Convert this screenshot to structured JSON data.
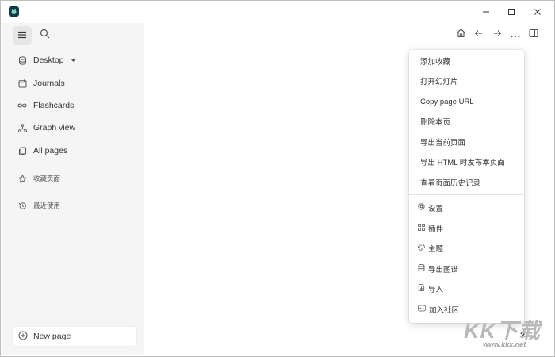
{
  "window": {
    "controls": {
      "minimize": "─",
      "maximize": "☐",
      "close": "✕"
    }
  },
  "sidebar": {
    "items": [
      {
        "label": "Desktop",
        "icon": "database-icon"
      },
      {
        "label": "Journals",
        "icon": "calendar-icon"
      },
      {
        "label": "Flashcards",
        "icon": "infinity-icon"
      },
      {
        "label": "Graph view",
        "icon": "graph-icon"
      },
      {
        "label": "All pages",
        "icon": "pages-icon"
      }
    ],
    "favorites_label": "收藏页面",
    "recent_label": "最近使用",
    "new_page_label": "New page"
  },
  "menu": {
    "top_items": [
      "添加收藏",
      "打开幻灯片",
      "Copy page URL",
      "删除本页",
      "导出当前页面",
      "导出 HTML 时发布本页面",
      "查看页面历史记录"
    ],
    "bottom_items": [
      {
        "label": "设置",
        "icon": "settings-icon"
      },
      {
        "label": "插件",
        "icon": "plugins-icon"
      },
      {
        "label": "主题",
        "icon": "palette-icon"
      },
      {
        "label": "导出图谱",
        "icon": "export-graph-icon"
      },
      {
        "label": "导入",
        "icon": "import-icon"
      },
      {
        "label": "加入社区",
        "icon": "community-icon"
      }
    ]
  },
  "help_label": "?",
  "watermark": {
    "brand": "KK下载",
    "url": "www.kkx.net"
  },
  "colors": {
    "sidebar_bg": "#f5f5f5",
    "logo": "#0e3b45"
  }
}
